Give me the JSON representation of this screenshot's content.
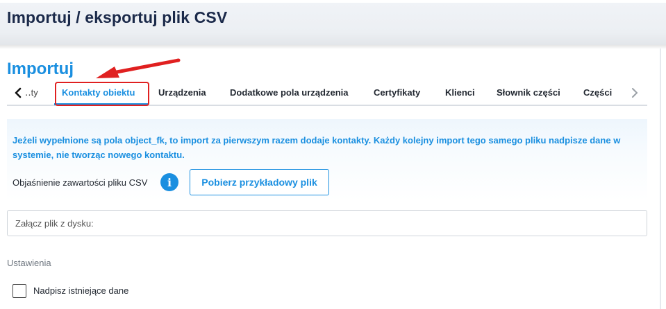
{
  "header": {
    "title": "Importuj / eksportuj plik CSV"
  },
  "section": {
    "title": "Importuj"
  },
  "tabs": {
    "prev_icon": "chevron-left-icon",
    "next_icon": "chevron-right-icon",
    "items": [
      {
        "label": "‥ty",
        "active": false
      },
      {
        "label": "Kontakty obiektu",
        "active": true
      },
      {
        "label": "Urządzenia",
        "active": false
      },
      {
        "label": "Dodatkowe pola urządzenia",
        "active": false
      },
      {
        "label": "Certyfikaty",
        "active": false
      },
      {
        "label": "Klienci",
        "active": false
      },
      {
        "label": "Słownik części",
        "active": false
      },
      {
        "label": "Części",
        "active": false
      }
    ]
  },
  "info": {
    "text": "Jeżeli wypełnione są pola object_fk, to import za pierwszym razem dodaje kontakty. Każdy kolejny import tego samego pliku nadpisze dane w systemie, nie tworząc nowego kontaktu.",
    "csv_label": "Objaśnienie zawartości pliku CSV",
    "info_icon": "i",
    "sample_button": "Pobierz przykładowy plik"
  },
  "file_input": {
    "placeholder": "Załącz plik z dysku:"
  },
  "settings": {
    "label": "Ustawienia",
    "overwrite_label": "Nadpisz istniejące dane",
    "overwrite_checked": false
  },
  "colors": {
    "accent": "#1a8fe0",
    "title": "#1b2a4a",
    "annotation": "#e02020"
  }
}
